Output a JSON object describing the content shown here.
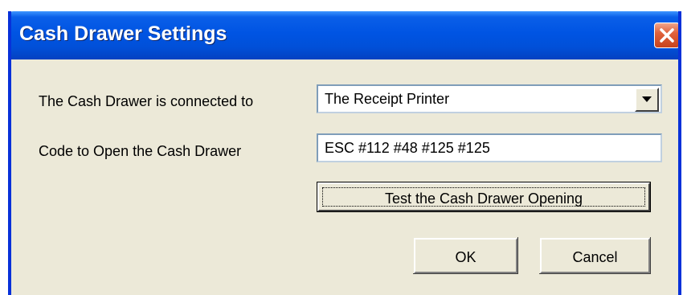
{
  "window": {
    "title": "Cash Drawer Settings",
    "close_icon": "close-icon"
  },
  "form": {
    "connected_label": "The Cash Drawer is connected to",
    "connected_value": "The Receipt Printer",
    "dropdown_icon": "chevron-down-icon",
    "code_label": "Code to Open the Cash Drawer",
    "code_value": "ESC #112 #48 #125 #125"
  },
  "buttons": {
    "test_label": "Test the Cash Drawer Opening",
    "ok_label": "OK",
    "cancel_label": "Cancel"
  },
  "colors": {
    "titlebar": "#0054e3",
    "window_bg": "#ece9d8",
    "close_button": "#e0623c"
  }
}
